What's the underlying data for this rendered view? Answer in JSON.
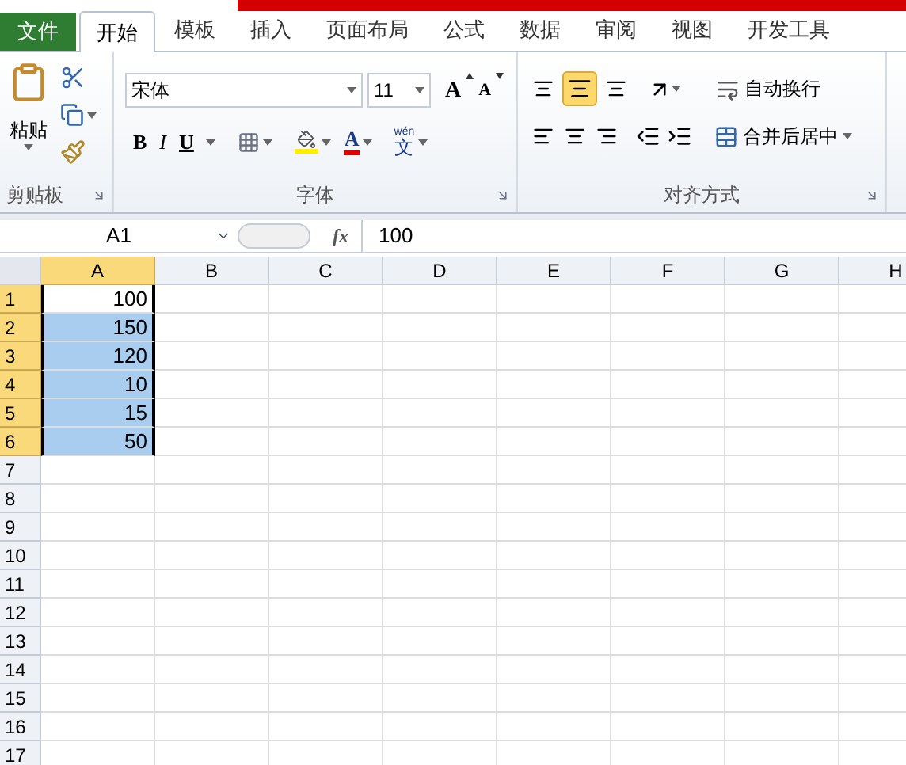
{
  "tabs": [
    {
      "label": "文件",
      "kind": "file",
      "selected": false
    },
    {
      "label": "开始",
      "kind": "tab",
      "selected": true
    },
    {
      "label": "模板",
      "kind": "tab",
      "selected": false
    },
    {
      "label": "插入",
      "kind": "tab",
      "selected": false
    },
    {
      "label": "页面布局",
      "kind": "tab",
      "selected": false
    },
    {
      "label": "公式",
      "kind": "tab",
      "selected": false
    },
    {
      "label": "数据",
      "kind": "tab",
      "selected": false
    },
    {
      "label": "审阅",
      "kind": "tab",
      "selected": false
    },
    {
      "label": "视图",
      "kind": "tab",
      "selected": false
    },
    {
      "label": "开发工具",
      "kind": "tab",
      "selected": false
    }
  ],
  "clipboard": {
    "paste_label": "粘贴",
    "group_label": "剪贴板"
  },
  "font": {
    "name": "宋体",
    "size": "11",
    "bold": "B",
    "italic": "I",
    "underline": "U",
    "grow": "A",
    "shrink": "A",
    "color_letter": "A",
    "phonetic_top": "wén",
    "phonetic_char": "文",
    "group_label": "字体"
  },
  "alignment": {
    "middle_align_selected": true,
    "wrap_label": "自动换行",
    "merge_label": "合并后居中",
    "group_label": "对齐方式"
  },
  "formula_bar": {
    "name_box": "A1",
    "fx": "fx",
    "value": "100"
  },
  "columns": [
    {
      "label": "A",
      "selected": true
    },
    {
      "label": "B",
      "selected": false
    },
    {
      "label": "C",
      "selected": false
    },
    {
      "label": "D",
      "selected": false
    },
    {
      "label": "E",
      "selected": false
    },
    {
      "label": "F",
      "selected": false
    },
    {
      "label": "G",
      "selected": false
    },
    {
      "label": "H",
      "selected": false
    }
  ],
  "rows": [
    {
      "label": "1",
      "selected": true,
      "cells": [
        {
          "value": "100",
          "selected": true,
          "active": true
        }
      ]
    },
    {
      "label": "2",
      "selected": true,
      "cells": [
        {
          "value": "150",
          "selected": true,
          "active": false
        }
      ]
    },
    {
      "label": "3",
      "selected": true,
      "cells": [
        {
          "value": "120",
          "selected": true,
          "active": false
        }
      ]
    },
    {
      "label": "4",
      "selected": true,
      "cells": [
        {
          "value": "10",
          "selected": true,
          "active": false
        }
      ]
    },
    {
      "label": "5",
      "selected": true,
      "cells": [
        {
          "value": "15",
          "selected": true,
          "active": false
        }
      ]
    },
    {
      "label": "6",
      "selected": true,
      "cells": [
        {
          "value": "50",
          "selected": true,
          "active": false
        }
      ]
    },
    {
      "label": "7",
      "selected": false
    },
    {
      "label": "8",
      "selected": false
    },
    {
      "label": "9",
      "selected": false
    },
    {
      "label": "10",
      "selected": false
    },
    {
      "label": "11",
      "selected": false
    },
    {
      "label": "12",
      "selected": false
    },
    {
      "label": "13",
      "selected": false
    },
    {
      "label": "14",
      "selected": false
    },
    {
      "label": "15",
      "selected": false
    },
    {
      "label": "16",
      "selected": false
    },
    {
      "label": "17",
      "selected": false
    }
  ]
}
